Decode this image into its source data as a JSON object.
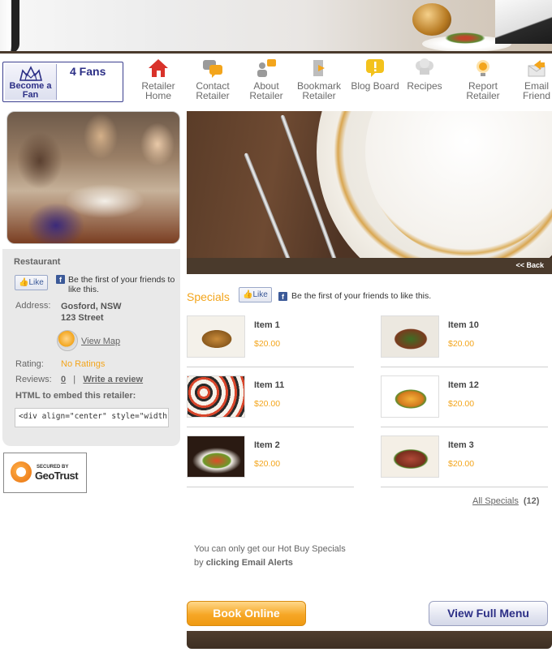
{
  "fan_box": {
    "button_label": "Become a Fan",
    "fan_count": "4 Fans"
  },
  "nav": {
    "items": [
      {
        "label": "Retailer Home",
        "icon": "home-icon",
        "color": "#d9322a"
      },
      {
        "label": "Contact Retailer",
        "icon": "chat-bubbles-icon",
        "color": "#f3a51c"
      },
      {
        "label": "About Retailer",
        "icon": "person-speech-icon",
        "color": "#f3a51c"
      },
      {
        "label": "Bookmark Retailer",
        "icon": "bookmark-icon",
        "color": "#f3a51c"
      },
      {
        "label": "Blog Board",
        "icon": "blog-alert-icon",
        "color": "#f3c21c"
      },
      {
        "label": "Recipes",
        "icon": "chef-hat-icon",
        "color": "#bdbdbd"
      },
      {
        "label": "Report Retailer",
        "icon": "alert-bulb-icon",
        "color": "#f3a51c"
      },
      {
        "label": "Email Friend",
        "icon": "envelope-arrow-icon",
        "color": "#f3a51c"
      }
    ]
  },
  "retailer": {
    "category": "Restaurant",
    "like_label": "Like",
    "like_text": "Be the first of your friends to like this.",
    "address_label": "Address:",
    "address_line1": "Gosford, NSW",
    "address_line2": "123 Street",
    "view_map": "View Map",
    "rating_label": "Rating:",
    "rating_value": "No Ratings",
    "reviews_label": "Reviews:",
    "reviews_count": "0",
    "reviews_sep": "|",
    "write_review": "Write a review",
    "embed_label": "HTML to embed this retailer:",
    "embed_code": "<div align=\"center\" style=\"width:208px"
  },
  "badge": {
    "secured_by": "SECURED BY",
    "name": "GeoTrust"
  },
  "hero": {
    "back_label": "<< Back"
  },
  "specials": {
    "title": "Specials",
    "like_label": "Like",
    "like_text": "Be the first of your friends to like this.",
    "items": [
      {
        "name": "Item 1",
        "price": "$20.00"
      },
      {
        "name": "Item 10",
        "price": "$20.00"
      },
      {
        "name": "Item 11",
        "price": "$20.00"
      },
      {
        "name": "Item 12",
        "price": "$20.00"
      },
      {
        "name": "Item 2",
        "price": "$20.00"
      },
      {
        "name": "Item 3",
        "price": "$20.00"
      }
    ],
    "all_label": "All Specials",
    "all_count": "(12)"
  },
  "hotbuy": {
    "line1": "You can only get our Hot Buy Specials",
    "line2_prefix": "by",
    "line2_bold": "clicking Email Alerts"
  },
  "actions": {
    "book_online": "Book Online",
    "view_menu": "View Full Menu"
  },
  "colors": {
    "accent": "#f3a51c",
    "brand": "#2c2f86",
    "brown": "#4a3a2c",
    "facebook": "#3b5998"
  }
}
